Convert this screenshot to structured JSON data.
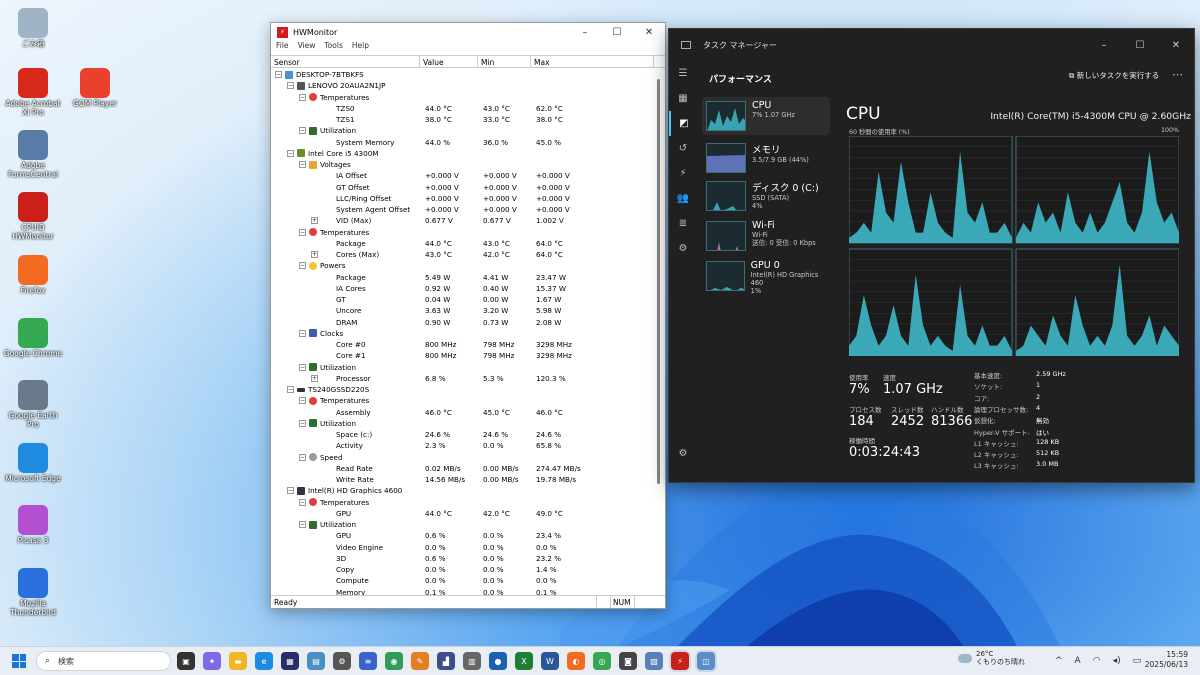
{
  "desktop": {
    "icons": [
      {
        "label": "ごみ箱",
        "icon": "recycle-bin-icon",
        "color": "#9fb4c7"
      },
      {
        "label": "Adobe Acrobat XI Pro",
        "icon": "acrobat-icon",
        "color": "#d9291c"
      },
      {
        "label": "GOM Player",
        "icon": "gom-player-icon",
        "color": "#e9412e"
      },
      {
        "label": "Adobe FormsCentral",
        "icon": "forms-central-icon",
        "color": "#5a7ca8"
      },
      {
        "label": "CPUID HWMonitor",
        "icon": "hwmonitor-icon",
        "color": "#c9201b"
      },
      {
        "label": "Firefox",
        "icon": "firefox-icon",
        "color": "#f36b21"
      },
      {
        "label": "Google Chrome",
        "icon": "chrome-icon",
        "color": "#34a853"
      },
      {
        "label": "Google Earth Pro",
        "icon": "google-earth-icon",
        "color": "#6b7a8a"
      },
      {
        "label": "Microsoft Edge",
        "icon": "edge-icon",
        "color": "#1f8be0"
      },
      {
        "label": "Picasa 3",
        "icon": "picasa-icon",
        "color": "#b34fd1"
      },
      {
        "label": "Mozilla Thunderbird",
        "icon": "thunderbird-icon",
        "color": "#2a6fdb"
      }
    ]
  },
  "hwmonitor": {
    "title": "HWMonitor",
    "menu": [
      "File",
      "View",
      "Tools",
      "Help"
    ],
    "columns": [
      "Sensor",
      "Value",
      "Min",
      "Max"
    ],
    "rows": [
      {
        "lvl": 0,
        "tg": "-",
        "ic": "pc",
        "name": "DESKTOP-7BTBKFS",
        "v": "",
        "mn": "",
        "mx": ""
      },
      {
        "lvl": 1,
        "tg": "-",
        "ic": "mb",
        "name": "LENOVO 20AUA2N1JP",
        "v": "",
        "mn": "",
        "mx": ""
      },
      {
        "lvl": 2,
        "tg": "-",
        "ic": "temp",
        "name": "Temperatures",
        "v": "",
        "mn": "",
        "mx": ""
      },
      {
        "lvl": 3,
        "tg": "",
        "ic": "",
        "name": "TZS0",
        "v": "44.0 °C",
        "mn": "43.0 °C",
        "mx": "62.0 °C"
      },
      {
        "lvl": 3,
        "tg": "",
        "ic": "",
        "name": "TZS1",
        "v": "38.0 °C",
        "mn": "33.0 °C",
        "mx": "38.0 °C"
      },
      {
        "lvl": 2,
        "tg": "-",
        "ic": "util",
        "name": "Utilization",
        "v": "",
        "mn": "",
        "mx": ""
      },
      {
        "lvl": 3,
        "tg": "",
        "ic": "",
        "name": "System Memory",
        "v": "44.0 %",
        "mn": "36.0 %",
        "mx": "45.0 %"
      },
      {
        "lvl": 1,
        "tg": "-",
        "ic": "cpu",
        "name": "Intel Core i5 4300M",
        "v": "",
        "mn": "",
        "mx": ""
      },
      {
        "lvl": 2,
        "tg": "-",
        "ic": "volt",
        "name": "Voltages",
        "v": "",
        "mn": "",
        "mx": ""
      },
      {
        "lvl": 3,
        "tg": "",
        "ic": "",
        "name": "IA Offset",
        "v": "+0.000 V",
        "mn": "+0.000 V",
        "mx": "+0.000 V"
      },
      {
        "lvl": 3,
        "tg": "",
        "ic": "",
        "name": "GT Offset",
        "v": "+0.000 V",
        "mn": "+0.000 V",
        "mx": "+0.000 V"
      },
      {
        "lvl": 3,
        "tg": "",
        "ic": "",
        "name": "LLC/Ring Offset",
        "v": "+0.000 V",
        "mn": "+0.000 V",
        "mx": "+0.000 V"
      },
      {
        "lvl": 3,
        "tg": "",
        "ic": "",
        "name": "System Agent Offset",
        "v": "+0.000 V",
        "mn": "+0.000 V",
        "mx": "+0.000 V"
      },
      {
        "lvl": 3,
        "tg": "+",
        "ic": "",
        "name": "VID (Max)",
        "v": "0.677 V",
        "mn": "0.677 V",
        "mx": "1.002 V"
      },
      {
        "lvl": 2,
        "tg": "-",
        "ic": "temp",
        "name": "Temperatures",
        "v": "",
        "mn": "",
        "mx": ""
      },
      {
        "lvl": 3,
        "tg": "",
        "ic": "",
        "name": "Package",
        "v": "44.0 °C",
        "mn": "43.0 °C",
        "mx": "64.0 °C"
      },
      {
        "lvl": 3,
        "tg": "+",
        "ic": "",
        "name": "Cores (Max)",
        "v": "43.0 °C",
        "mn": "42.0 °C",
        "mx": "64.0 °C"
      },
      {
        "lvl": 2,
        "tg": "-",
        "ic": "pow",
        "name": "Powers",
        "v": "",
        "mn": "",
        "mx": ""
      },
      {
        "lvl": 3,
        "tg": "",
        "ic": "",
        "name": "Package",
        "v": "5.49 W",
        "mn": "4.41 W",
        "mx": "23.47 W"
      },
      {
        "lvl": 3,
        "tg": "",
        "ic": "",
        "name": "IA Cores",
        "v": "0.92 W",
        "mn": "0.40 W",
        "mx": "15.37 W"
      },
      {
        "lvl": 3,
        "tg": "",
        "ic": "",
        "name": "GT",
        "v": "0.04 W",
        "mn": "0.00 W",
        "mx": "1.67 W"
      },
      {
        "lvl": 3,
        "tg": "",
        "ic": "",
        "name": "Uncore",
        "v": "3.63 W",
        "mn": "3.20 W",
        "mx": "5.98 W"
      },
      {
        "lvl": 3,
        "tg": "",
        "ic": "",
        "name": "DRAM",
        "v": "0.90 W",
        "mn": "0.73 W",
        "mx": "2.08 W"
      },
      {
        "lvl": 2,
        "tg": "-",
        "ic": "clk",
        "name": "Clocks",
        "v": "",
        "mn": "",
        "mx": ""
      },
      {
        "lvl": 3,
        "tg": "",
        "ic": "",
        "name": "Core #0",
        "v": "800 MHz",
        "mn": "798 MHz",
        "mx": "3298 MHz"
      },
      {
        "lvl": 3,
        "tg": "",
        "ic": "",
        "name": "Core #1",
        "v": "800 MHz",
        "mn": "798 MHz",
        "mx": "3298 MHz"
      },
      {
        "lvl": 2,
        "tg": "-",
        "ic": "util",
        "name": "Utilization",
        "v": "",
        "mn": "",
        "mx": ""
      },
      {
        "lvl": 3,
        "tg": "+",
        "ic": "",
        "name": "Processor",
        "v": "6.8 %",
        "mn": "5.3 %",
        "mx": "120.3 %"
      },
      {
        "lvl": 1,
        "tg": "-",
        "ic": "disk",
        "name": "TS240GSSD220S",
        "v": "",
        "mn": "",
        "mx": ""
      },
      {
        "lvl": 2,
        "tg": "-",
        "ic": "temp",
        "name": "Temperatures",
        "v": "",
        "mn": "",
        "mx": ""
      },
      {
        "lvl": 3,
        "tg": "",
        "ic": "",
        "name": "Assembly",
        "v": "46.0 °C",
        "mn": "45.0 °C",
        "mx": "46.0 °C"
      },
      {
        "lvl": 2,
        "tg": "-",
        "ic": "util",
        "name": "Utilization",
        "v": "",
        "mn": "",
        "mx": ""
      },
      {
        "lvl": 3,
        "tg": "",
        "ic": "",
        "name": "Space (c:)",
        "v": "24.6 %",
        "mn": "24.6 %",
        "mx": "24.6 %"
      },
      {
        "lvl": 3,
        "tg": "",
        "ic": "",
        "name": "Activity",
        "v": "2.3 %",
        "mn": "0.0 %",
        "mx": "65.8 %"
      },
      {
        "lvl": 2,
        "tg": "-",
        "ic": "speed",
        "name": "Speed",
        "v": "",
        "mn": "",
        "mx": ""
      },
      {
        "lvl": 3,
        "tg": "",
        "ic": "",
        "name": "Read Rate",
        "v": "0.02 MB/s",
        "mn": "0.00 MB/s",
        "mx": "274.47 MB/s"
      },
      {
        "lvl": 3,
        "tg": "",
        "ic": "",
        "name": "Write Rate",
        "v": "14.56 MB/s",
        "mn": "0.00 MB/s",
        "mx": "19.78 MB/s"
      },
      {
        "lvl": 1,
        "tg": "-",
        "ic": "gpu",
        "name": "Intel(R) HD Graphics 4600",
        "v": "",
        "mn": "",
        "mx": ""
      },
      {
        "lvl": 2,
        "tg": "-",
        "ic": "temp",
        "name": "Temperatures",
        "v": "",
        "mn": "",
        "mx": ""
      },
      {
        "lvl": 3,
        "tg": "",
        "ic": "",
        "name": "GPU",
        "v": "44.0 °C",
        "mn": "42.0 °C",
        "mx": "49.0 °C"
      },
      {
        "lvl": 2,
        "tg": "-",
        "ic": "util",
        "name": "Utilization",
        "v": "",
        "mn": "",
        "mx": ""
      },
      {
        "lvl": 3,
        "tg": "",
        "ic": "",
        "name": "GPU",
        "v": "0.6 %",
        "mn": "0.0 %",
        "mx": "23.4 %"
      },
      {
        "lvl": 3,
        "tg": "",
        "ic": "",
        "name": "Video Engine",
        "v": "0.0 %",
        "mn": "0.0 %",
        "mx": "0.0 %"
      },
      {
        "lvl": 3,
        "tg": "",
        "ic": "",
        "name": "3D",
        "v": "0.6 %",
        "mn": "0.0 %",
        "mx": "23.2 %"
      },
      {
        "lvl": 3,
        "tg": "",
        "ic": "",
        "name": "Copy",
        "v": "0.0 %",
        "mn": "0.0 %",
        "mx": "1.4 %"
      },
      {
        "lvl": 3,
        "tg": "",
        "ic": "",
        "name": "Compute",
        "v": "0.0 %",
        "mn": "0.0 %",
        "mx": "0.0 %"
      },
      {
        "lvl": 3,
        "tg": "",
        "ic": "",
        "name": "Memory",
        "v": "0.1 %",
        "mn": "0.0 %",
        "mx": "0.1 %"
      }
    ],
    "status": {
      "left": "Ready",
      "num": "NUM"
    }
  },
  "taskmgr": {
    "title": "タスク マネージャー",
    "page_title": "パフォーマンス",
    "run_task": "新しいタスクを実行する",
    "items": [
      {
        "t1": "CPU",
        "t2": "7%  1.07 GHz",
        "t3": "",
        "t4": "",
        "kind": "cpu"
      },
      {
        "t1": "メモリ",
        "t2": "3.5/7.9 GB (44%)",
        "t3": "",
        "t4": "",
        "kind": "mem"
      },
      {
        "t1": "ディスク 0 (C:)",
        "t2": "SSD (SATA)",
        "t3": "4%",
        "t4": "",
        "kind": "disk"
      },
      {
        "t1": "Wi-Fi",
        "t2": "Wi-Fi",
        "t3": "送信: 0  受信: 0 Kbps",
        "t4": "",
        "kind": "wifi"
      },
      {
        "t1": "GPU 0",
        "t2": "Intel(R) HD Graphics 460",
        "t3": "1%",
        "t4": "",
        "kind": "gpu"
      }
    ],
    "cpu_title": "CPU",
    "cpu_name": "Intel(R) Core(TM) i5-4300M CPU @ 2.60GHz",
    "graph_left": "60 秒間の使用率 (%)",
    "graph_right": "100%",
    "stats": {
      "util_label": "使用率",
      "util": "7%",
      "speed_label": "速度",
      "speed": "1.07 GHz",
      "proc_label": "プロセス数",
      "proc": "184",
      "thr_label": "スレッド数",
      "thr": "2452",
      "hnd_label": "ハンドル数",
      "hnd": "81366",
      "up_label": "稼働時間",
      "up": "0:03:24:43"
    },
    "info": [
      {
        "k": "基本速度:",
        "v": "2.59 GHz"
      },
      {
        "k": "ソケット:",
        "v": "1"
      },
      {
        "k": "コア:",
        "v": "2"
      },
      {
        "k": "論理プロセッサ数:",
        "v": "4"
      },
      {
        "k": "仮想化:",
        "v": "無効"
      },
      {
        "k": "Hyper-V サポート:",
        "v": "はい"
      },
      {
        "k": "L1 キャッシュ:",
        "v": "128 KB"
      },
      {
        "k": "L2 キャッシュ:",
        "v": "512 KB"
      },
      {
        "k": "L3 キャッシュ:",
        "v": "3.0 MB"
      }
    ],
    "accent": "#4cc2ff",
    "graph_color": "#3fb8c9"
  },
  "taskbar": {
    "search_placeholder": "検索",
    "weather_temp": "26°C",
    "weather_desc": "くもりのち晴れ",
    "time": "15:59",
    "date": "2025/06/13"
  }
}
